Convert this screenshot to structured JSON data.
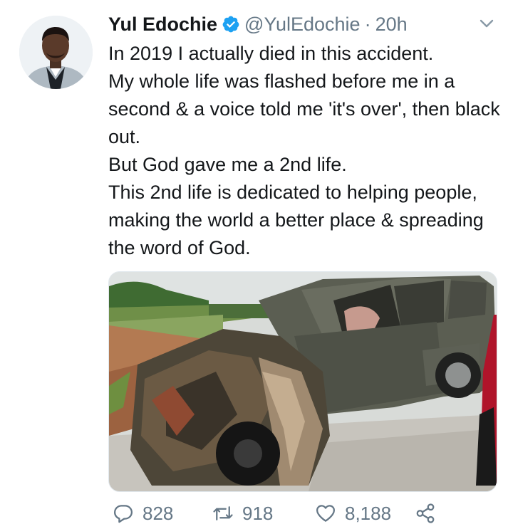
{
  "tweet": {
    "author_name": "Yul Edochie",
    "handle": "@YulEdochie",
    "separator": "·",
    "time": "20h",
    "text": "In 2019 I actually died in this accident.\nMy whole life was flashed before me in a second & a voice told me 'it's over', then black out.\nBut God gave me a 2nd life.\nThis 2nd life is dedicated to helping people, making the world a better place & spreading the word of God.",
    "icons": {
      "verified": "verified-badge-icon",
      "more": "chevron-down-icon",
      "reply": "reply-icon",
      "retweet": "retweet-icon",
      "like": "heart-icon",
      "share": "share-icon"
    },
    "colors": {
      "verified": "#1da1f2",
      "secondary_text": "#657786",
      "primary_text": "#14171a"
    }
  },
  "actions": {
    "reply_count": "828",
    "retweet_count": "918",
    "like_count": "8,188"
  }
}
